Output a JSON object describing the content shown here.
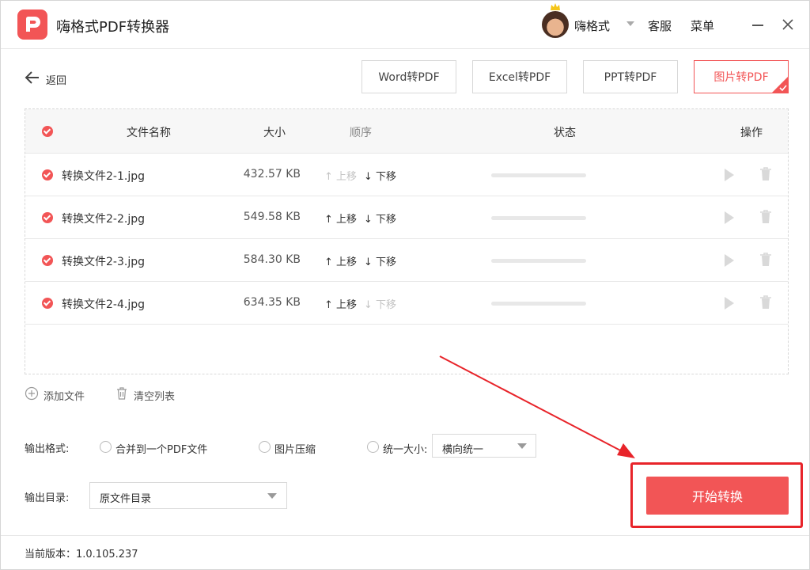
{
  "app": {
    "title": "嗨格式PDF转换器"
  },
  "header": {
    "user_name": "嗨格式",
    "service": "客服",
    "menu": "菜单"
  },
  "toolbar": {
    "back_label": "返回",
    "modes": [
      "Word转PDF",
      "Excel转PDF",
      "PPT转PDF",
      "图片转PDF"
    ],
    "active_mode": "图片转PDF"
  },
  "table": {
    "columns": {
      "name": "文件名称",
      "size": "大小",
      "order": "顺序",
      "status": "状态",
      "action": "操作"
    },
    "move_up": "上移",
    "move_down": "下移",
    "rows": [
      {
        "name": "转换文件2-1.jpg",
        "size": "432.57 KB",
        "up_enabled": false,
        "down_enabled": true
      },
      {
        "name": "转换文件2-2.jpg",
        "size": "549.58 KB",
        "up_enabled": true,
        "down_enabled": true
      },
      {
        "name": "转换文件2-3.jpg",
        "size": "584.30 KB",
        "up_enabled": true,
        "down_enabled": true
      },
      {
        "name": "转换文件2-4.jpg",
        "size": "634.35 KB",
        "up_enabled": true,
        "down_enabled": false
      }
    ]
  },
  "actions": {
    "add_file": "添加文件",
    "clear_list": "清空列表"
  },
  "output": {
    "format_label": "输出格式:",
    "merge_option": "合并到一个PDF文件",
    "compress_option": "图片压缩",
    "unify_option": "统一大小:",
    "unify_select": "横向统一",
    "dir_label": "输出目录:",
    "dir_select": "原文件目录"
  },
  "start_button": "开始转换",
  "footer": {
    "version": "当前版本：1.0.105.237"
  },
  "colors": {
    "accent": "#f25556",
    "highlight": "#e8242a"
  }
}
